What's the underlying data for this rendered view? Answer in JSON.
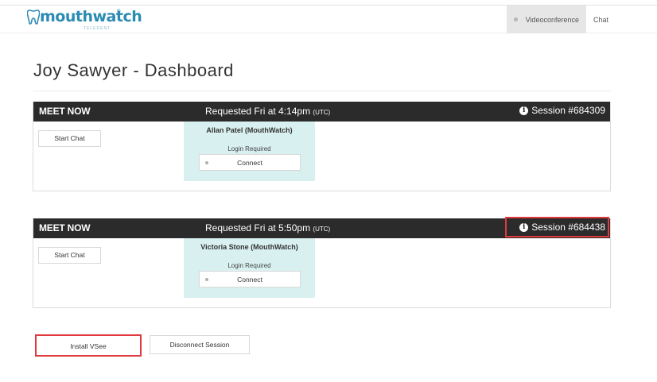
{
  "header": {
    "logo": {
      "brand": "mouthwatch",
      "trademark": "®",
      "sub": "TELEDENT"
    },
    "nav": [
      {
        "label": "Videoconference",
        "active": true,
        "icon": "status-dot-icon"
      },
      {
        "label": "Chat",
        "active": false
      }
    ]
  },
  "page": {
    "title": "Joy Sawyer - Dashboard"
  },
  "sessions": [
    {
      "type": "MEET NOW",
      "requested": "Requested Fri at 4:14pm",
      "tz": "(UTC)",
      "session_label": "Session #684309",
      "start_chat_label": "Start Chat",
      "provider": "Allan Patel (MouthWatch)",
      "login_required": "Login Required",
      "connect_label": "Connect"
    },
    {
      "type": "MEET NOW",
      "requested": "Requested Fri at 5:50pm",
      "tz": "(UTC)",
      "session_label": "Session #684438",
      "start_chat_label": "Start Chat",
      "provider": "Victoria Stone (MouthWatch)",
      "login_required": "Login Required",
      "connect_label": "Connect"
    }
  ],
  "actions": {
    "install_label": "Install VSee",
    "disconnect_label": "Disconnect Session"
  },
  "colors": {
    "header_bg": "#2b2b2b",
    "provider_bg": "#d9f0f0",
    "brand": "#2b8bb3",
    "highlight": "#e0393e"
  }
}
